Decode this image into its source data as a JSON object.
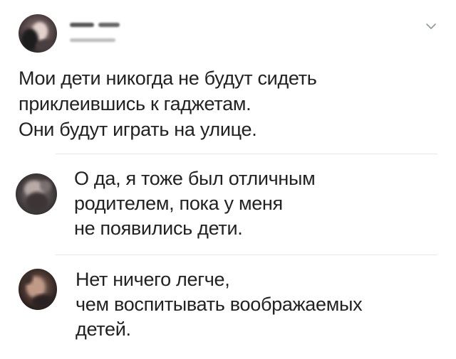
{
  "main_tweet": {
    "lines": [
      "Мои дети никогда не будут сидеть",
      "приклеившись к гаджетам.",
      "Они будут играть на улице."
    ]
  },
  "replies": [
    {
      "lines": [
        "О да, я тоже был отличным",
        "родителем, пока у меня",
        "не появились дети."
      ]
    },
    {
      "lines": [
        "Нет ничего легче,",
        "чем воспитывать воображаемых",
        "детей."
      ]
    }
  ],
  "icons": {
    "menu": "chevron-down-icon"
  },
  "colors": {
    "text": "#222222",
    "divider": "#e6e6e6",
    "chevron": "#8899a6"
  }
}
